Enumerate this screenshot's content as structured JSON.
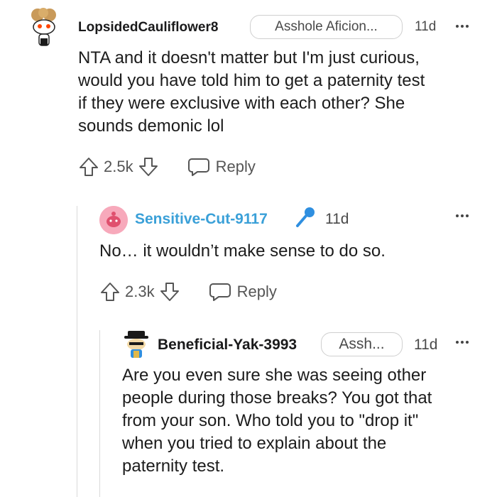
{
  "comments": [
    {
      "username": "LopsidedCauliflower8",
      "flair": "Asshole Aficion...",
      "time": "11d",
      "body_lines": [
        "NTA and it doesn't matter but I'm just curious,",
        "would you have told him to get a paternity test",
        "if they were exclusive with each other? She",
        "sounds demonic lol"
      ],
      "score": "2.5k",
      "reply_label": "Reply"
    },
    {
      "username": "Sensitive-Cut-9117",
      "badge": "microphone-icon",
      "time": "11d",
      "body_lines": [
        "No… it wouldn’t make sense to do so."
      ],
      "score": "2.3k",
      "reply_label": "Reply",
      "username_color": "#3aa0d8"
    },
    {
      "username": "Beneficial-Yak-3993",
      "flair": "Assh...",
      "time": "11d",
      "body_lines": [
        "Are you even sure she was seeing other",
        "people during those breaks? You got that",
        "from your son. Who told you to \"drop it\"",
        "when you tried to explain about the",
        "paternity test."
      ]
    }
  ]
}
